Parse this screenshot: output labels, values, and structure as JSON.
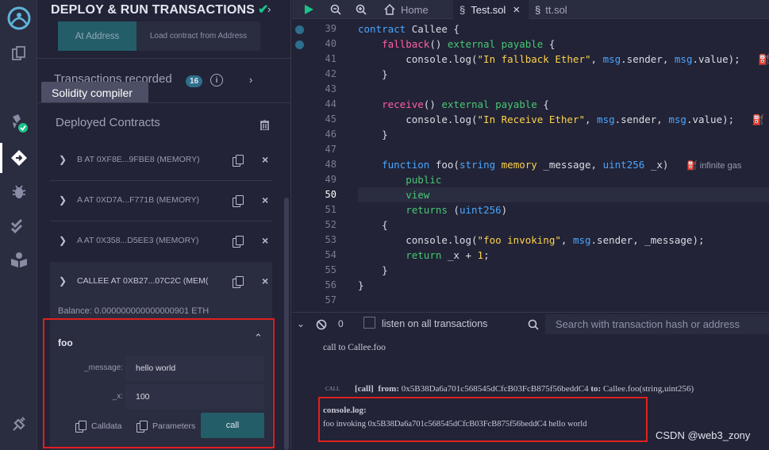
{
  "sidebar": {
    "title": "DEPLOY & RUN TRANSACTIONS",
    "at_address_label": "At Address",
    "load_contract_label": "Load contract from Address",
    "tx_recorded_label": "Transactions recorded",
    "tx_recorded_count": "16",
    "tooltip_text": "Solidity compiler",
    "deployed_label": "Deployed Contracts",
    "contracts": [
      {
        "name": "B AT 0XF8E...9FBE8 (MEMORY)"
      },
      {
        "name": "A AT 0XD7A...F771B (MEMORY)"
      },
      {
        "name": "A AT 0X358...D5EE3 (MEMORY)"
      },
      {
        "name": "CALLEE AT 0XB27...07C2C (MEM("
      }
    ],
    "balance_label": "Balance: 0.000000000000000901 ETH",
    "function": {
      "name": "foo",
      "params": [
        {
          "label": "_message:",
          "value": "hello world"
        },
        {
          "label": "_x:",
          "value": "100"
        }
      ],
      "calldata_label": "Calldata",
      "parameters_label": "Parameters",
      "call_label": "call"
    }
  },
  "rail_icons": [
    "remix-logo-icon",
    "file-explorer-icon",
    "compiler-icon",
    "deploy-icon",
    "debugger-icon",
    "test-icon",
    "learn-icon",
    "plugin-icon"
  ],
  "tabs": {
    "home_label": "Home",
    "tab1_label": "Test.sol",
    "tab2_label": "tt.sol"
  },
  "editor": {
    "lines": [
      {
        "no": "39"
      },
      {
        "no": "40"
      },
      {
        "no": "41"
      },
      {
        "no": "42"
      },
      {
        "no": "43"
      },
      {
        "no": "44"
      },
      {
        "no": "45"
      },
      {
        "no": "46"
      },
      {
        "no": "47"
      },
      {
        "no": "48"
      },
      {
        "no": "49"
      },
      {
        "no": "50"
      },
      {
        "no": "51"
      },
      {
        "no": "52"
      },
      {
        "no": "53"
      },
      {
        "no": "54"
      },
      {
        "no": "55"
      },
      {
        "no": "56"
      },
      {
        "no": "57"
      }
    ],
    "gas_note": "infinite gas"
  },
  "terminal": {
    "counter": "0",
    "listen_label": "listen on all transactions",
    "search_placeholder": "Search with transaction hash or address",
    "call_line": "call to Callee.foo",
    "call_tag": "CALL",
    "call_detail_prefix": "[call]",
    "from_label": "from:",
    "from_addr": "0x5B38Da6a701c568545dCfcB03FcB875f56beddC4",
    "to_label": "to:",
    "to_value": "Callee.foo(string,uint256)",
    "console_log_label": "console.log:",
    "console_log_output": "foo invoking 0x5B38Da6a701c568545dCfcB03FcB875f56beddC4 hello world"
  },
  "watermark": "CSDN @web3_zony"
}
